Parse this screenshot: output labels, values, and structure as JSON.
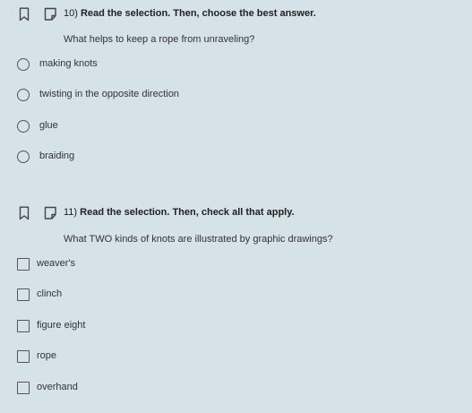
{
  "questions": [
    {
      "number": "10)",
      "instruction": "Read the selection. Then, choose the best answer.",
      "prompt": "What helps to keep a rope from unraveling?",
      "type": "radio",
      "options": [
        "making knots",
        "twisting in the opposite direction",
        "glue",
        "braiding"
      ]
    },
    {
      "number": "11)",
      "instruction": "Read the selection. Then, check all that apply.",
      "prompt": "What TWO kinds of knots are illustrated by graphic drawings?",
      "type": "checkbox",
      "options": [
        "weaver's",
        "clinch",
        "figure eight",
        "rope",
        "overhand"
      ]
    }
  ],
  "icons": {
    "bookmark": "bookmark-icon",
    "note": "note-icon"
  },
  "colors": {
    "background": "#d5e2e8",
    "control_border": "#555555",
    "text": "#333333"
  }
}
